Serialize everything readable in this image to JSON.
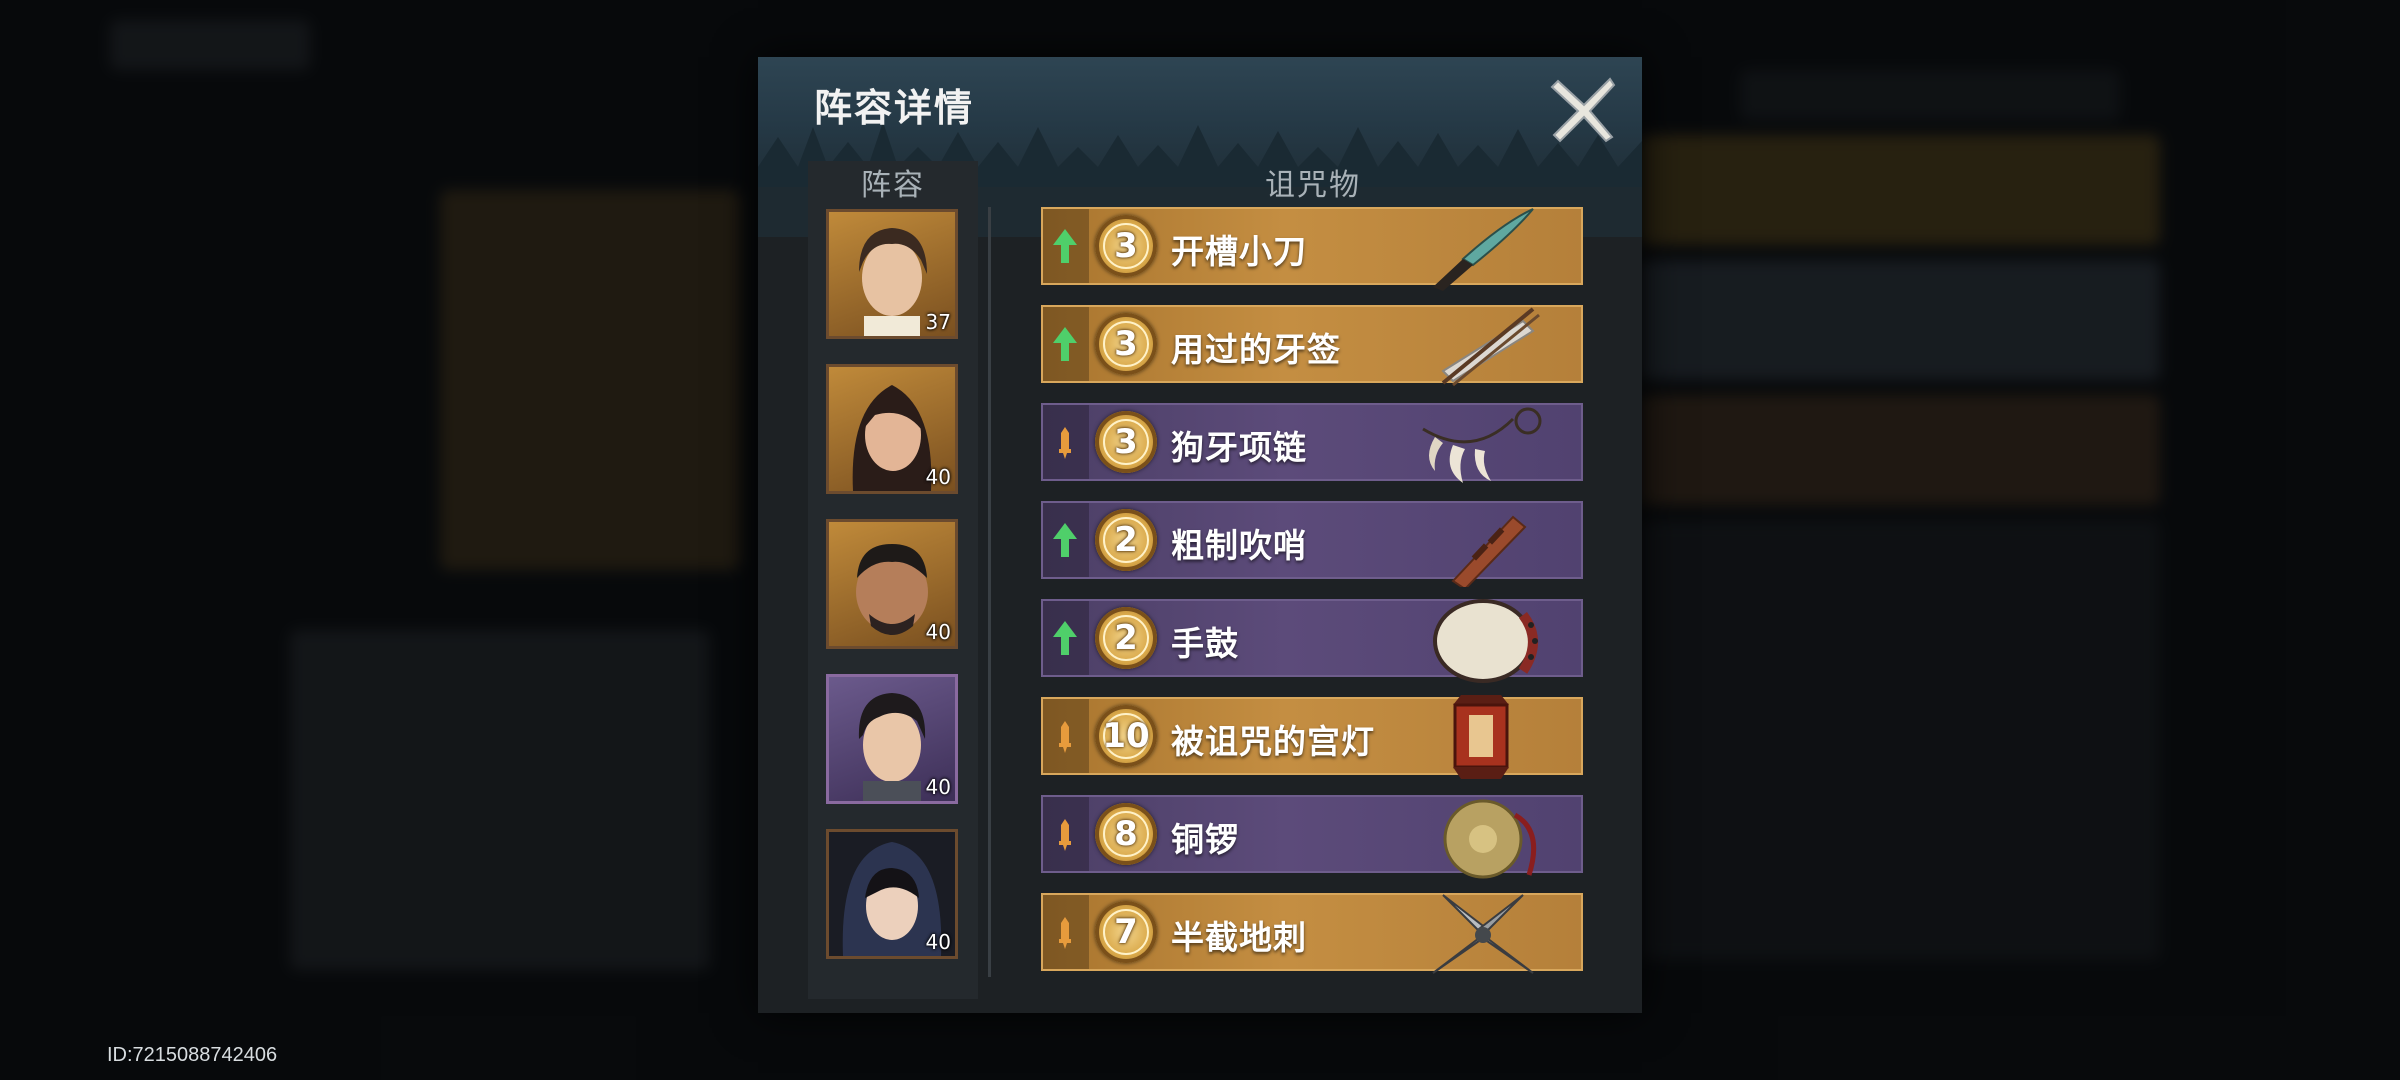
{
  "page": {
    "id_text": "ID:7215088742406"
  },
  "dialog": {
    "title": "阵容详情",
    "team_label": "阵容",
    "curse_label": "诅咒物",
    "close_icon": "close-x-icon"
  },
  "team": [
    {
      "level": "37",
      "frame": "gold"
    },
    {
      "level": "40",
      "frame": "gold"
    },
    {
      "level": "40",
      "frame": "gold"
    },
    {
      "level": "40",
      "frame": "purple"
    },
    {
      "level": "40",
      "frame": "gold"
    }
  ],
  "curse_items": [
    {
      "count": "3",
      "name": "开槽小刀",
      "rarity": "gold",
      "arrow": "green-up-arrow-icon",
      "icon": "knife-icon"
    },
    {
      "count": "3",
      "name": "用过的牙签",
      "rarity": "gold",
      "arrow": "green-up-arrow-icon",
      "icon": "toothpick-icon"
    },
    {
      "count": "3",
      "name": "狗牙项链",
      "rarity": "purple",
      "arrow": "orange-dagger-icon",
      "icon": "fang-necklace-icon"
    },
    {
      "count": "2",
      "name": "粗制吹哨",
      "rarity": "purple",
      "arrow": "green-up-arrow-icon",
      "icon": "whistle-icon"
    },
    {
      "count": "2",
      "name": "手鼓",
      "rarity": "purple",
      "arrow": "green-up-arrow-icon",
      "icon": "hand-drum-icon"
    },
    {
      "count": "10",
      "name": "被诅咒的宫灯",
      "rarity": "gold",
      "arrow": "orange-dagger-icon",
      "icon": "palace-lantern-icon"
    },
    {
      "count": "8",
      "name": "铜锣",
      "rarity": "purple",
      "arrow": "orange-dagger-icon",
      "icon": "gong-icon"
    },
    {
      "count": "7",
      "name": "半截地刺",
      "rarity": "gold",
      "arrow": "orange-dagger-icon",
      "icon": "caltrop-icon"
    }
  ],
  "colors": {
    "gold_row": "#c48e42",
    "purple_row": "#5c4b7a",
    "green_arrow": "#4fcf6a",
    "orange_marker": "#e79b3c"
  }
}
